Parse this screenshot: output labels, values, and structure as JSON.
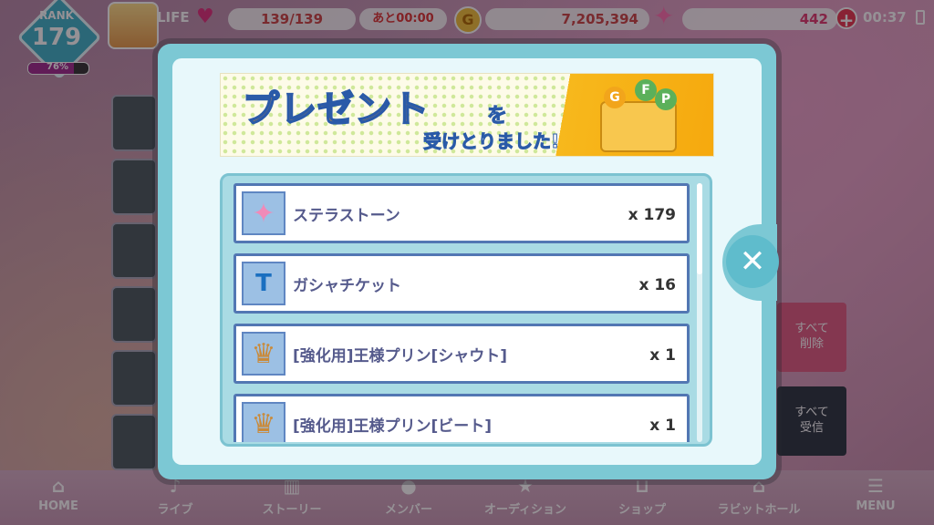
{
  "hud": {
    "rank_label": "RANK",
    "rank_value": "179",
    "rank_progress_pct": "76%",
    "rank_progress": 0.76,
    "life_label": "LIFE",
    "life_value": "139/139",
    "life_timer": "あと00:00",
    "coin_symbol": "G",
    "coins": "7,205,394",
    "stones": "442",
    "clock": "00:37"
  },
  "side_buttons": {
    "delete_all": "すべて\n削除",
    "receive_all": "すべて\n受信"
  },
  "modal": {
    "banner_title": "プレゼント",
    "banner_wo": "を",
    "banner_sub": "受けとりました!",
    "banner_letters": [
      "G",
      "F",
      "P"
    ],
    "items": [
      {
        "name": "ステラストーン",
        "qty": "x 179",
        "icon": "stella-stone-icon"
      },
      {
        "name": "ガシャチケット",
        "qty": "x 16",
        "icon": "gacha-ticket-icon"
      },
      {
        "name": "[強化用]王様プリン[シャウト]",
        "qty": "x 1",
        "icon": "king-pudding-shout-icon"
      },
      {
        "name": "[強化用]王様プリン[ビート]",
        "qty": "x 1",
        "icon": "king-pudding-beat-icon"
      }
    ]
  },
  "nav": [
    {
      "label": "HOME",
      "icon": "home-icon"
    },
    {
      "label": "ライブ",
      "icon": "music-note-icon"
    },
    {
      "label": "ストーリー",
      "icon": "book-icon"
    },
    {
      "label": "メンバー",
      "icon": "member-icon"
    },
    {
      "label": "オーディション",
      "icon": "audition-icon"
    },
    {
      "label": "ショップ",
      "icon": "shop-basket-icon"
    },
    {
      "label": "ラビットホール",
      "icon": "rabbit-hall-icon"
    },
    {
      "label": "MENU",
      "icon": "menu-icon"
    }
  ],
  "colors": {
    "accent": "#7cc8d4",
    "row_border": "#5277b3",
    "banner_orange": "#f79a1b"
  }
}
